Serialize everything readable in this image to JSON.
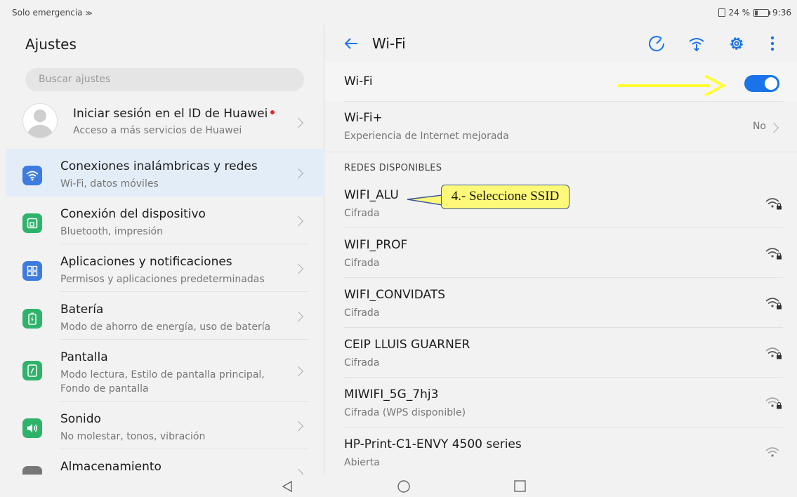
{
  "status_bar": {
    "left_text": "Solo emergencia",
    "battery_text": "24 %",
    "battery_level": 0.24,
    "time": "9:36"
  },
  "settings": {
    "title": "Ajustes",
    "search_placeholder": "Buscar ajustes",
    "account": {
      "title": "Iniciar sesión en el ID de Huawei",
      "subtitle": "Acceso a más servicios de Huawei"
    },
    "items": [
      {
        "title": "Conexiones inalámbricas y redes",
        "subtitle": "Wi-Fi, datos móviles",
        "icon": "wifi-icon",
        "color": "#3d7be0"
      },
      {
        "title": "Conexión del dispositivo",
        "subtitle": "Bluetooth, impresión",
        "icon": "device-connection-icon",
        "color": "#2fb36b"
      },
      {
        "title": "Aplicaciones y notificaciones",
        "subtitle": "Permisos y aplicaciones predeterminadas",
        "icon": "apps-icon",
        "color": "#3d7be0"
      },
      {
        "title": "Batería",
        "subtitle": "Modo de ahorro de energía, uso de batería",
        "icon": "battery-icon",
        "color": "#2fb36b"
      },
      {
        "title": "Pantalla",
        "subtitle": "Modo lectura, Estilo de pantalla principal, Fondo de pantalla",
        "icon": "display-icon",
        "color": "#2fb36b"
      },
      {
        "title": "Sonido",
        "subtitle": "No molestar, tonos, vibración",
        "icon": "sound-icon",
        "color": "#2fb36b"
      },
      {
        "title": "Almacenamiento",
        "subtitle": "",
        "icon": "storage-icon",
        "color": "#777777"
      }
    ]
  },
  "wifi": {
    "title": "Wi-Fi",
    "toggle_label": "Wi-Fi",
    "toggle_on": true,
    "wifi_plus": {
      "title": "Wi-Fi+",
      "subtitle": "Experiencia de Internet mejorada",
      "value": "No"
    },
    "section_label": "REDES DISPONIBLES",
    "networks": [
      {
        "name": "WIFI_ALU",
        "status": "Cifrada",
        "locked": true
      },
      {
        "name": "WIFI_PROF",
        "status": "Cifrada",
        "locked": true
      },
      {
        "name": "WIFI_CONVIDATS",
        "status": "Cifrada",
        "locked": true
      },
      {
        "name": "CEIP LLUIS GUARNER",
        "status": "Cifrada",
        "locked": true
      },
      {
        "name": "MIWIFI_5G_7hj3",
        "status": "Cifrada (WPS disponible)",
        "locked": true
      },
      {
        "name": "HP-Print-C1-ENVY 4500 series",
        "status": "Abierta",
        "locked": false
      }
    ],
    "annotation": "4.- Seleccione SSID"
  },
  "colors": {
    "accent": "#1a73e8",
    "annotation_fill": "#fff97a",
    "annotation_arrow": "#ffff33"
  }
}
